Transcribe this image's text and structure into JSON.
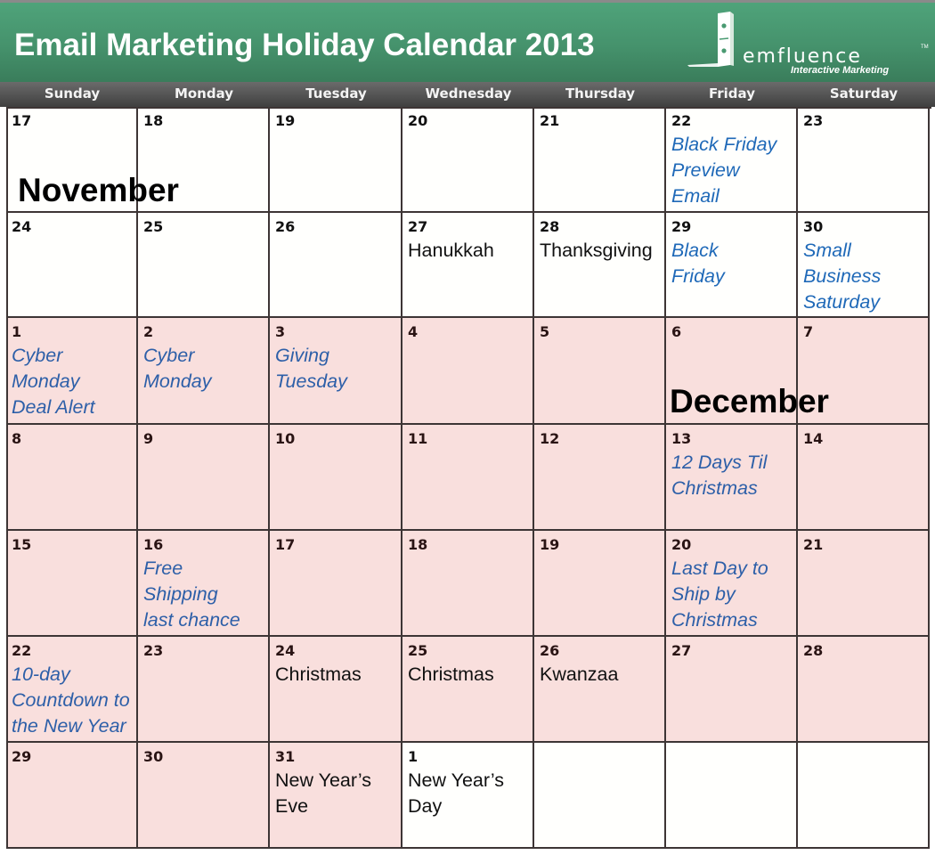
{
  "header": {
    "title": "Email Marketing Holiday Calendar 2013",
    "logo": {
      "icon": "domino-icon",
      "wordmark": "emfluence",
      "trademark": "TM",
      "tagline": "Interactive Marketing"
    },
    "colors": {
      "banner": "#4a9a72",
      "daybar": "#505050"
    }
  },
  "weekdays": [
    "Sunday",
    "Monday",
    "Tuesday",
    "Wednesday",
    "Thursday",
    "Friday",
    "Saturday"
  ],
  "month_labels": {
    "november": "November",
    "december": "December"
  },
  "colors": {
    "promo_text": "#1f69b8",
    "december_fill": "#f9dfdd",
    "november_fill": "#fffffd"
  },
  "weeks": [
    [
      {
        "day": "17",
        "month": "nov",
        "event": "",
        "type": ""
      },
      {
        "day": "18",
        "month": "nov",
        "event": "",
        "type": ""
      },
      {
        "day": "19",
        "month": "nov",
        "event": "",
        "type": ""
      },
      {
        "day": "20",
        "month": "nov",
        "event": "",
        "type": ""
      },
      {
        "day": "21",
        "month": "nov",
        "event": "",
        "type": ""
      },
      {
        "day": "22",
        "month": "nov",
        "event": "Black Friday\nPreview\nEmail",
        "type": "promo"
      },
      {
        "day": "23",
        "month": "nov",
        "event": "",
        "type": ""
      }
    ],
    [
      {
        "day": "24",
        "month": "nov",
        "event": "",
        "type": ""
      },
      {
        "day": "25",
        "month": "nov",
        "event": "",
        "type": ""
      },
      {
        "day": "26",
        "month": "nov",
        "event": "",
        "type": ""
      },
      {
        "day": "27",
        "month": "nov",
        "event": "Hanukkah",
        "type": "holiday"
      },
      {
        "day": "28",
        "month": "nov",
        "event": "Thanksgiving",
        "type": "holiday"
      },
      {
        "day": "29",
        "month": "nov",
        "event": "Black\nFriday",
        "type": "promo"
      },
      {
        "day": "30",
        "month": "nov",
        "event": "Small\nBusiness\nSaturday",
        "type": "promo"
      }
    ],
    [
      {
        "day": "1",
        "month": "dec",
        "event": "Cyber\nMonday\nDeal Alert",
        "type": "promo"
      },
      {
        "day": "2",
        "month": "dec",
        "event": "Cyber\nMonday",
        "type": "promo"
      },
      {
        "day": "3",
        "month": "dec",
        "event": "Giving\nTuesday",
        "type": "promo"
      },
      {
        "day": "4",
        "month": "dec",
        "event": "",
        "type": ""
      },
      {
        "day": "5",
        "month": "dec",
        "event": "",
        "type": ""
      },
      {
        "day": "6",
        "month": "dec",
        "event": "",
        "type": ""
      },
      {
        "day": "7",
        "month": "dec",
        "event": "",
        "type": ""
      }
    ],
    [
      {
        "day": "8",
        "month": "dec",
        "event": "",
        "type": ""
      },
      {
        "day": "9",
        "month": "dec",
        "event": "",
        "type": ""
      },
      {
        "day": "10",
        "month": "dec",
        "event": "",
        "type": ""
      },
      {
        "day": "11",
        "month": "dec",
        "event": "",
        "type": ""
      },
      {
        "day": "12",
        "month": "dec",
        "event": "",
        "type": ""
      },
      {
        "day": "13",
        "month": "dec",
        "event": "12 Days Til\nChristmas",
        "type": "promo"
      },
      {
        "day": "14",
        "month": "dec",
        "event": "",
        "type": ""
      }
    ],
    [
      {
        "day": "15",
        "month": "dec",
        "event": "",
        "type": ""
      },
      {
        "day": "16",
        "month": "dec",
        "event": "Free\nShipping\nlast chance",
        "type": "promo"
      },
      {
        "day": "17",
        "month": "dec",
        "event": "",
        "type": ""
      },
      {
        "day": "18",
        "month": "dec",
        "event": "",
        "type": ""
      },
      {
        "day": "19",
        "month": "dec",
        "event": "",
        "type": ""
      },
      {
        "day": "20",
        "month": "dec",
        "event": "Last Day to\nShip by\nChristmas",
        "type": "promo"
      },
      {
        "day": "21",
        "month": "dec",
        "event": "",
        "type": ""
      }
    ],
    [
      {
        "day": "22",
        "month": "dec",
        "event": "10-day\nCountdown to\nthe New Year",
        "type": "promo"
      },
      {
        "day": "23",
        "month": "dec",
        "event": "",
        "type": ""
      },
      {
        "day": "24",
        "month": "dec",
        "event": "Christmas",
        "type": "holiday"
      },
      {
        "day": "25",
        "month": "dec",
        "event": "Christmas",
        "type": "holiday"
      },
      {
        "day": "26",
        "month": "dec",
        "event": "Kwanzaa",
        "type": "holiday"
      },
      {
        "day": "27",
        "month": "dec",
        "event": "",
        "type": ""
      },
      {
        "day": "28",
        "month": "dec",
        "event": "",
        "type": ""
      }
    ],
    [
      {
        "day": "29",
        "month": "dec",
        "event": "",
        "type": ""
      },
      {
        "day": "30",
        "month": "dec",
        "event": "",
        "type": ""
      },
      {
        "day": "31",
        "month": "dec",
        "event": "New Year’s\nEve",
        "type": "holiday"
      },
      {
        "day": "1",
        "month": "jan",
        "event": "New Year’s\nDay",
        "type": "holiday"
      },
      {
        "day": "",
        "month": "blank",
        "event": "",
        "type": ""
      },
      {
        "day": "",
        "month": "blank",
        "event": "",
        "type": ""
      },
      {
        "day": "",
        "month": "blank",
        "event": "",
        "type": ""
      }
    ]
  ]
}
